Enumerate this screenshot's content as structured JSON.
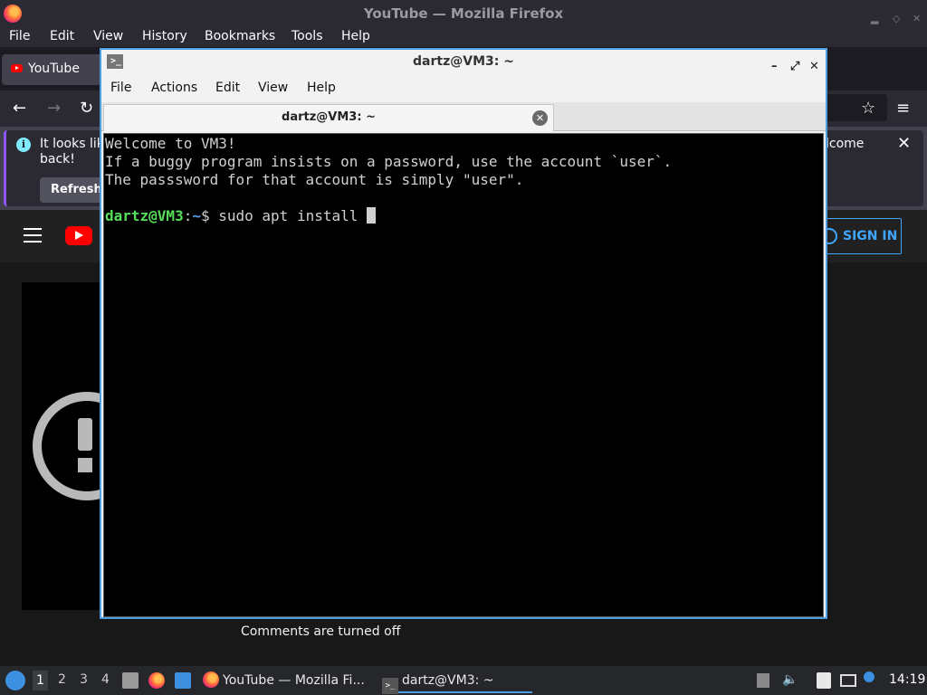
{
  "firefox": {
    "window_title": "YouTube — Mozilla Firefox",
    "menu": [
      "File",
      "Edit",
      "View",
      "History",
      "Bookmarks",
      "Tools",
      "Help"
    ],
    "tab_label": "YouTube",
    "notification": {
      "text_line1": "It looks lik",
      "text_line2": "back!",
      "text_right": "lcome",
      "button": "Refresh"
    },
    "youtube": {
      "sign_in": "SIGN IN",
      "comments_text": "Comments are turned off"
    }
  },
  "terminal": {
    "window_title": "dartz@VM3: ~",
    "menu": [
      "File",
      "Actions",
      "Edit",
      "View",
      "Help"
    ],
    "tab_label": "dartz@VM3: ~",
    "lines": [
      "Welcome to VM3!",
      "If a buggy program insists on a password, use the account `user`.",
      "The passsword for that account is simply \"user\"."
    ],
    "prompt_user": "dartz@VM3",
    "prompt_sep": ":",
    "prompt_path": "~",
    "prompt_symbol": "$ ",
    "command": "sudo apt install "
  },
  "taskbar": {
    "desktops": [
      "1",
      "2",
      "3",
      "4"
    ],
    "active_desktop": "1",
    "items": [
      {
        "label": "YouTube — Mozilla Fi...",
        "icon": "firefox-icon"
      },
      {
        "label": "dartz@VM3: ~",
        "icon": "terminal-icon"
      }
    ],
    "clock": "14:19"
  },
  "colors": {
    "terminal_border": "#4d9de0",
    "prompt_user": "#55e05a",
    "prompt_path": "#5c9cf5",
    "youtube_red": "#ff0000",
    "signin_blue": "#3ea6ff"
  }
}
